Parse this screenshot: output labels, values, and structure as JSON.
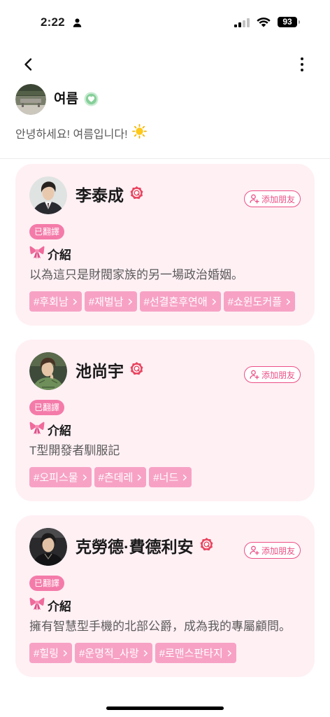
{
  "status_bar": {
    "time": "2:22",
    "battery_level": "93",
    "icons": [
      "person-icon",
      "signal-icon",
      "wifi-icon",
      "battery-icon"
    ]
  },
  "header": {
    "back_icon": "chevron-left-icon",
    "menu_icon": "more-vertical-icon"
  },
  "profile": {
    "name": "여름",
    "badge_icon": "heart-badge-icon",
    "bio": "안녕하세요! 여름입니다!",
    "bio_icon": "sun-icon"
  },
  "cards": [
    {
      "name": "李泰成",
      "verified_icon": "verified-badge-icon",
      "add_friend_label": "添加朋友",
      "translated_label": "已翻譯",
      "intro_icon": "ribbon-icon",
      "intro_label": "介紹",
      "description": "以為這只是財閥家族的另一場政治婚姻。",
      "tags": [
        "#후회남",
        "#재벌남",
        "#선결혼후연애",
        "#쇼윈도커플"
      ]
    },
    {
      "name": "池尚宇",
      "verified_icon": "verified-badge-icon",
      "add_friend_label": "添加朋友",
      "translated_label": "已翻譯",
      "intro_icon": "ribbon-icon",
      "intro_label": "介紹",
      "description": "T型開發者馴服記",
      "tags": [
        "#오피스물",
        "#츤데레",
        "#너드"
      ]
    },
    {
      "name": "克勞德·費德利安",
      "verified_icon": "verified-badge-icon",
      "add_friend_label": "添加朋友",
      "translated_label": "已翻譯",
      "intro_icon": "ribbon-icon",
      "intro_label": "介紹",
      "description": "擁有智慧型手機的北部公爵，成為我的專屬顧問。",
      "tags": [
        "#힐링",
        "#운명적_사랑",
        "#로맨스판타지"
      ]
    }
  ],
  "colors": {
    "card_background": "#fff0f4",
    "accent": "#ec4f86",
    "translated_pill": "#f47ba9",
    "tag_background": "#f7a2c5",
    "verified_badge": "#ea4560",
    "profile_badge": "#86cf99"
  }
}
